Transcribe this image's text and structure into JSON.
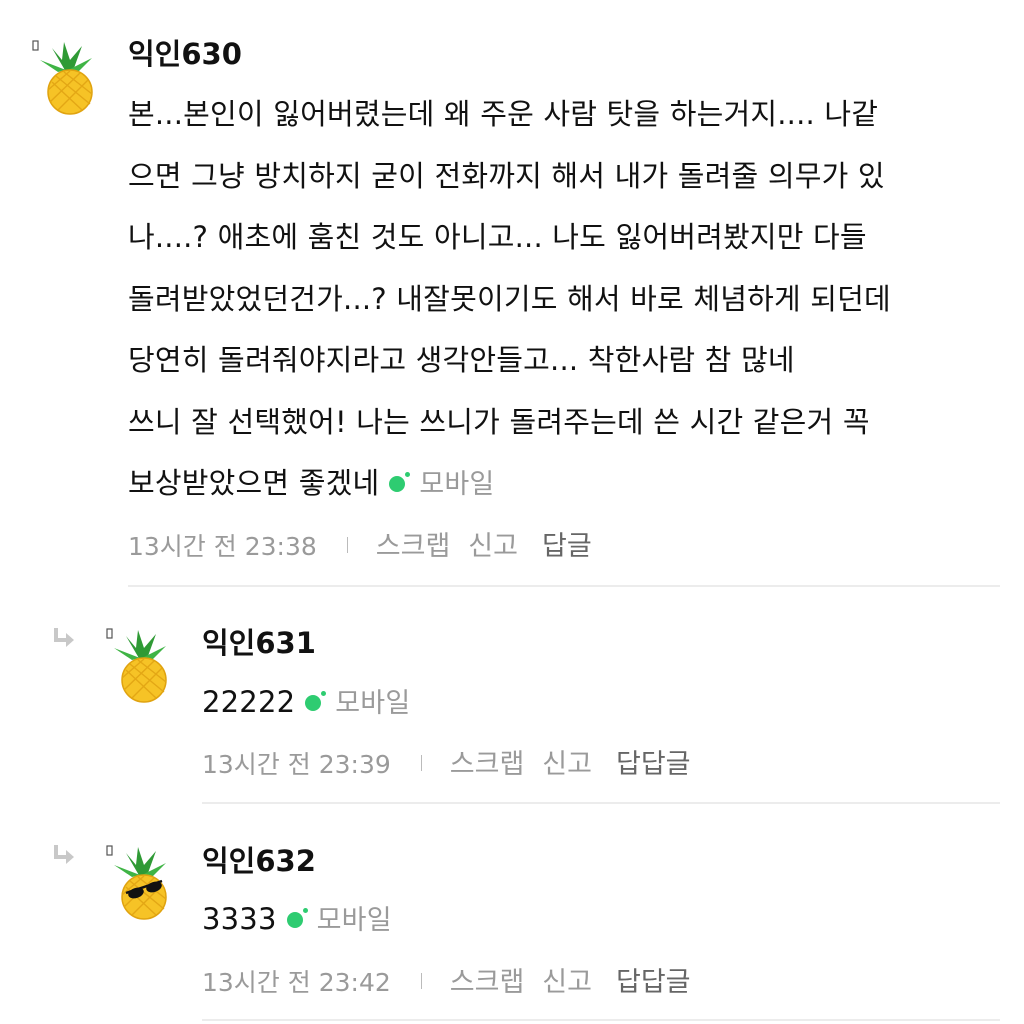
{
  "comments": [
    {
      "nickname": "익인630",
      "lines": [
        "본...본인이 잃어버렸는데 왜 주운 사람 탓을 하는거지.... 나같",
        "으면 그냥 방치하지 굳이 전화까지 해서 내가 돌려줄 의무가 있",
        "나....? 애초에 훔친 것도 아니고... 나도 잃어버려봤지만 다들",
        "돌려받았었던건가...? 내잘못이기도 해서 바로 체념하게 되던데",
        "당연히 돌려줘야지라고 생각안들고... 착한사람 참 많네",
        "쓰니 잘 선택했어! 나는 쓰니가 돌려주는데 쓴 시간 같은거 꼭",
        "보상받았으면 좋겠네"
      ],
      "device": "모바일",
      "time": "13시간 전  23:38",
      "scrap": "스크랩",
      "report": "신고",
      "reply": "답글"
    },
    {
      "nickname": "익인631",
      "lines": [
        "22222"
      ],
      "device": "모바일",
      "time": "13시간 전  23:39",
      "scrap": "스크랩",
      "report": "신고",
      "reply": "답답글"
    },
    {
      "nickname": "익인632",
      "lines": [
        "3333"
      ],
      "device": "모바일",
      "time": "13시간 전  23:42",
      "scrap": "스크랩",
      "report": "신고",
      "reply": "답답글"
    }
  ],
  "icons": {
    "avatar": "pineapple-icon",
    "avatar_sunglasses": "pineapple-sunglasses-icon",
    "reply": "reply-arrow-icon",
    "device": "mobile-dot-icon"
  },
  "colors": {
    "mobile_dot": "#2ecc71",
    "meta_text": "#9a9a9a",
    "divider": "#ececec"
  }
}
